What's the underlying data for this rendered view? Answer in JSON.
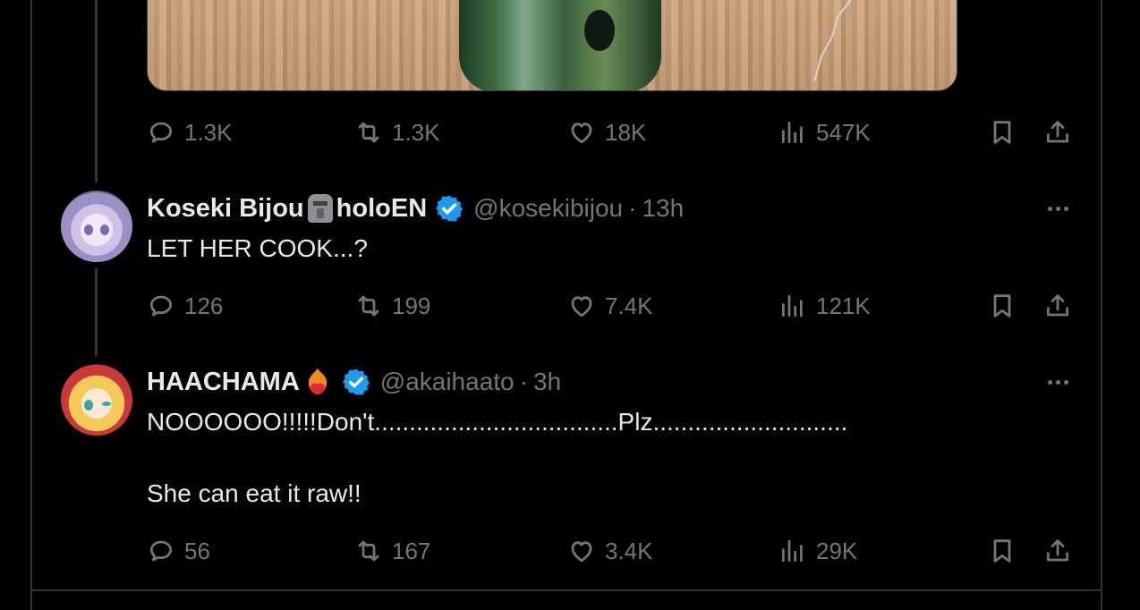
{
  "first_post": {
    "stats": {
      "replies": "1.3K",
      "reposts": "1.3K",
      "likes": "18K",
      "views": "547K"
    }
  },
  "replies": [
    {
      "display_name": "Koseki Bijou",
      "name_emoji": "moai",
      "name_suffix": "holoEN",
      "verified": true,
      "handle": "@kosekibijou",
      "separator": "·",
      "time": "13h",
      "text": "LET HER COOK...?",
      "stats": {
        "replies": "126",
        "reposts": "199",
        "likes": "7.4K",
        "views": "121K"
      }
    },
    {
      "display_name": "HAACHAMA",
      "name_emoji": "heart-on-fire",
      "name_suffix": "",
      "verified": true,
      "handle": "@akaihaato",
      "separator": "·",
      "time": "3h",
      "text_line1": "NOOOOOO!!!!!Don't...................................Plz............................",
      "text_line2": "She can eat it raw!!",
      "stats": {
        "replies": "56",
        "reposts": "167",
        "likes": "3.4K",
        "views": "29K"
      }
    }
  ],
  "colors": {
    "background": "#000000",
    "text": "#e7e9ea",
    "muted": "#71767b",
    "verified": "#1d9bf0",
    "divider": "#2f3336"
  },
  "icons": [
    "reply-icon",
    "repost-icon",
    "like-icon",
    "views-icon",
    "bookmark-icon",
    "share-icon",
    "verified-badge-icon",
    "more-icon"
  ]
}
